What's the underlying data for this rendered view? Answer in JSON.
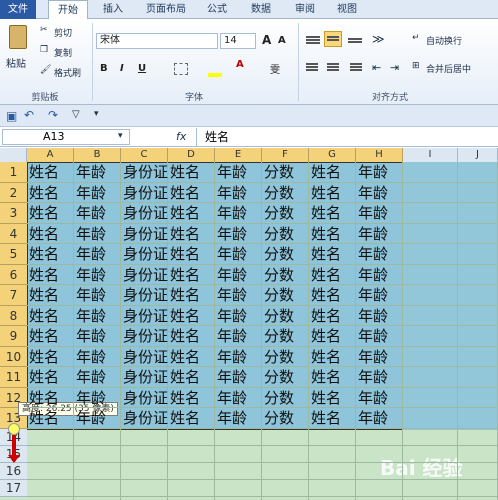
{
  "tabs": [
    "文件",
    "开始",
    "插入",
    "页面布局",
    "公式",
    "数据",
    "审阅",
    "视图"
  ],
  "clipboard": {
    "paste": "粘贴",
    "cut": "剪切",
    "copy": "复制",
    "format_painter": "格式刷",
    "label": "剪贴板"
  },
  "font": {
    "name": "宋体",
    "size": "14",
    "bold": "B",
    "italic": "I",
    "underline": "U",
    "grow": "A",
    "shrink": "A",
    "phonetic": "雯",
    "label": "字体"
  },
  "alignment": {
    "wrap": "自动换行",
    "merge": "合并后居中",
    "label": "对齐方式"
  },
  "formula_bar": {
    "name_box": "A13",
    "fx": "fx",
    "value": "姓名"
  },
  "columns": [
    "A",
    "B",
    "C",
    "D",
    "E",
    "F",
    "G",
    "H",
    "I",
    "J"
  ],
  "rows": [
    "1",
    "2",
    "3",
    "4",
    "5",
    "6",
    "7",
    "8",
    "9",
    "10",
    "11",
    "12",
    "13",
    "14",
    "15",
    "16",
    "17"
  ],
  "row_values": [
    "姓名",
    "年龄",
    "身份证",
    "姓名",
    "年龄",
    "分数",
    "姓名",
    "年龄"
  ],
  "tooltip": "高度: 26.25 (35 像素)",
  "watermark": "Bai 经验",
  "colors": {
    "selected_header": "#f4d27a",
    "selection_fill": "#8ec5da",
    "sheet_bg": "#c9e4c6"
  }
}
